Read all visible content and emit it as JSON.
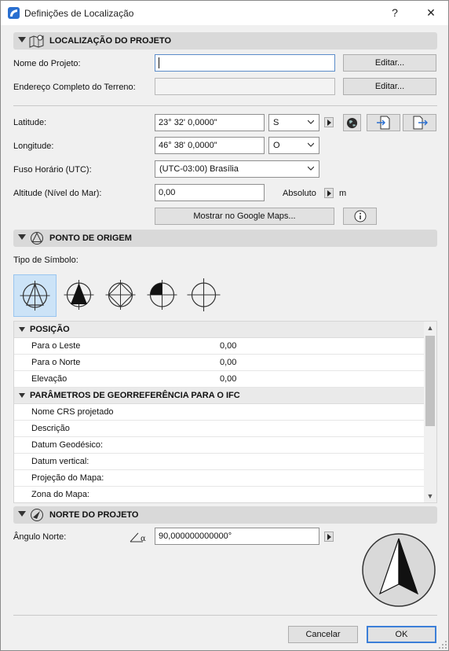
{
  "window": {
    "title": "Definições de Localização",
    "help_label": "?",
    "close_label": "✕"
  },
  "project_location": {
    "header": "LOCALIZAÇÃO DO PROJETO",
    "project_name_label": "Nome do Projeto:",
    "project_name_value": "",
    "site_address_label": "Endereço Completo do Terreno:",
    "site_address_value": "",
    "edit_label": "Editar...",
    "latitude_label": "Latitude:",
    "latitude_value": "23° 32' 0,0000\"",
    "latitude_dir": "S",
    "longitude_label": "Longitude:",
    "longitude_value": "46° 38' 0,0000\"",
    "longitude_dir": "O",
    "timezone_label": "Fuso Horário (UTC):",
    "timezone_value": "(UTC-03:00) Brasília",
    "altitude_label": "Altitude (Nível do Mar):",
    "altitude_value": "0,00",
    "altitude_mode": "Absoluto",
    "altitude_unit": "m",
    "google_maps_label": "Mostrar no Google Maps..."
  },
  "origin": {
    "header": "PONTO DE ORIGEM",
    "symbol_type_label": "Tipo de Símbolo:",
    "selected_symbol": 1
  },
  "tree": {
    "groups": [
      {
        "name": "POSIÇÃO",
        "rows": [
          {
            "name": "Para o Leste",
            "value": "0,00"
          },
          {
            "name": "Para o Norte",
            "value": "0,00"
          },
          {
            "name": "Elevação",
            "value": "0,00"
          }
        ]
      },
      {
        "name": "PARÂMETROS DE GEORREFERÊNCIA PARA O IFC",
        "rows": [
          {
            "name": "Nome CRS projetado",
            "value": ""
          },
          {
            "name": "Descrição",
            "value": ""
          },
          {
            "name": "Datum Geodésico:",
            "value": ""
          },
          {
            "name": "Datum vertical:",
            "value": ""
          },
          {
            "name": "Projeção do Mapa:",
            "value": ""
          },
          {
            "name": "Zona do Mapa:",
            "value": ""
          }
        ]
      }
    ]
  },
  "north": {
    "header": "NORTE DO PROJETO",
    "angle_label": "Ângulo Norte:",
    "angle_value": "90,000000000000°"
  },
  "footer": {
    "cancel_label": "Cancelar",
    "ok_label": "OK"
  },
  "colors": {
    "accent": "#3c7fd8",
    "selection": "#cce3f7",
    "header_bg": "#d9d9d9"
  }
}
